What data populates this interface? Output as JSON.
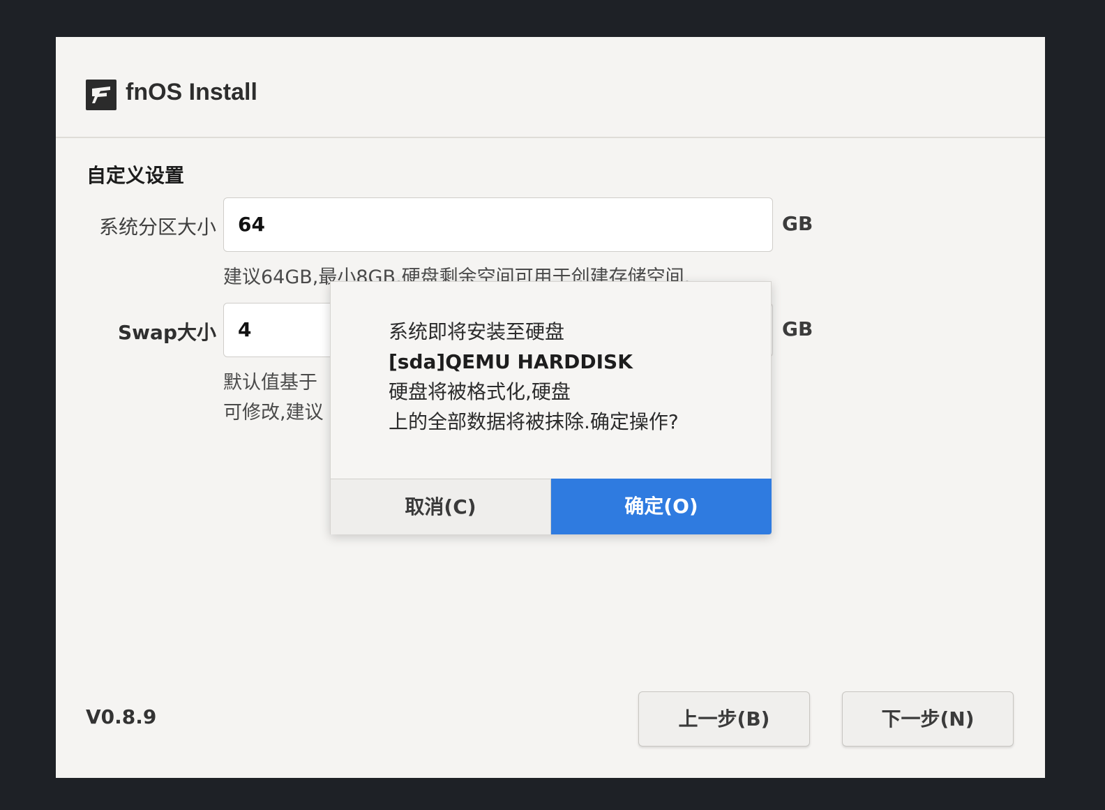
{
  "app": {
    "title": "fnOS Install",
    "logo_icon": "fnos-logo-icon"
  },
  "settings": {
    "section_title": "自定义设置",
    "system_partition": {
      "label": "系统分区大小",
      "value": "64",
      "unit": "GB",
      "hint": "建议64GB,最小8GB,硬盘剩余空间可用于创建存储空间."
    },
    "swap": {
      "label": "Swap大小",
      "value": "4",
      "unit": "GB",
      "hint_line1": "默认值基于",
      "hint_line2": "可修改,建议"
    }
  },
  "dialog": {
    "line1": "系统即将安装至硬盘",
    "line2": "[sda]QEMU HARDDISK",
    "line3": "硬盘将被格式化,硬盘",
    "line4": "上的全部数据将被抹除.确定操作?",
    "cancel_label": "取消(C)",
    "ok_label": "确定(O)"
  },
  "footer": {
    "version": "V0.8.9",
    "back_label": "上一步(B)",
    "next_label": "下一步(N)"
  },
  "colors": {
    "background": "#1e2126",
    "window": "#f5f4f2",
    "accent": "#2f7be0"
  }
}
